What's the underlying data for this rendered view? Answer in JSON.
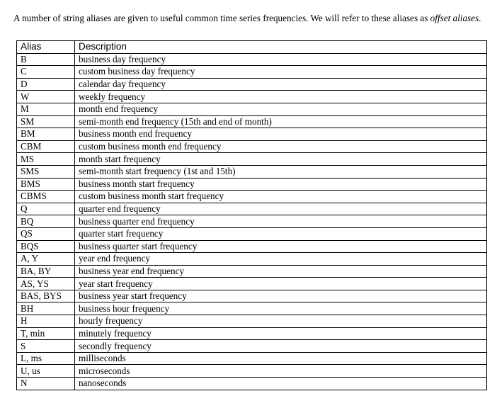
{
  "intro": {
    "text_before": "A number of string aliases are given to useful common time series frequencies. We will refer to these aliases as ",
    "emphasis": "offset aliases",
    "text_after": "."
  },
  "table": {
    "headers": [
      "Alias",
      "Description"
    ],
    "rows": [
      [
        "B",
        "business day frequency"
      ],
      [
        "C",
        "custom business day frequency"
      ],
      [
        "D",
        "calendar day frequency"
      ],
      [
        "W",
        "weekly frequency"
      ],
      [
        "M",
        "month end frequency"
      ],
      [
        "SM",
        "semi-month end frequency (15th and end of month)"
      ],
      [
        "BM",
        "business month end frequency"
      ],
      [
        "CBM",
        "custom business month end frequency"
      ],
      [
        "MS",
        "month start frequency"
      ],
      [
        "SMS",
        "semi-month start frequency (1st and 15th)"
      ],
      [
        "BMS",
        "business month start frequency"
      ],
      [
        "CBMS",
        "custom business month start frequency"
      ],
      [
        "Q",
        "quarter end frequency"
      ],
      [
        "BQ",
        "business quarter end frequency"
      ],
      [
        "QS",
        "quarter start frequency"
      ],
      [
        "BQS",
        "business quarter start frequency"
      ],
      [
        "A, Y",
        "year end frequency"
      ],
      [
        "BA, BY",
        "business year end frequency"
      ],
      [
        "AS, YS",
        "year start frequency"
      ],
      [
        "BAS, BYS",
        "business year start frequency"
      ],
      [
        "BH",
        "business hour frequency"
      ],
      [
        "H",
        "hourly frequency"
      ],
      [
        "T, min",
        "minutely frequency"
      ],
      [
        "S",
        "secondly frequency"
      ],
      [
        "L, ms",
        "milliseconds"
      ],
      [
        "U, us",
        "microseconds"
      ],
      [
        "N",
        "nanoseconds"
      ]
    ]
  }
}
